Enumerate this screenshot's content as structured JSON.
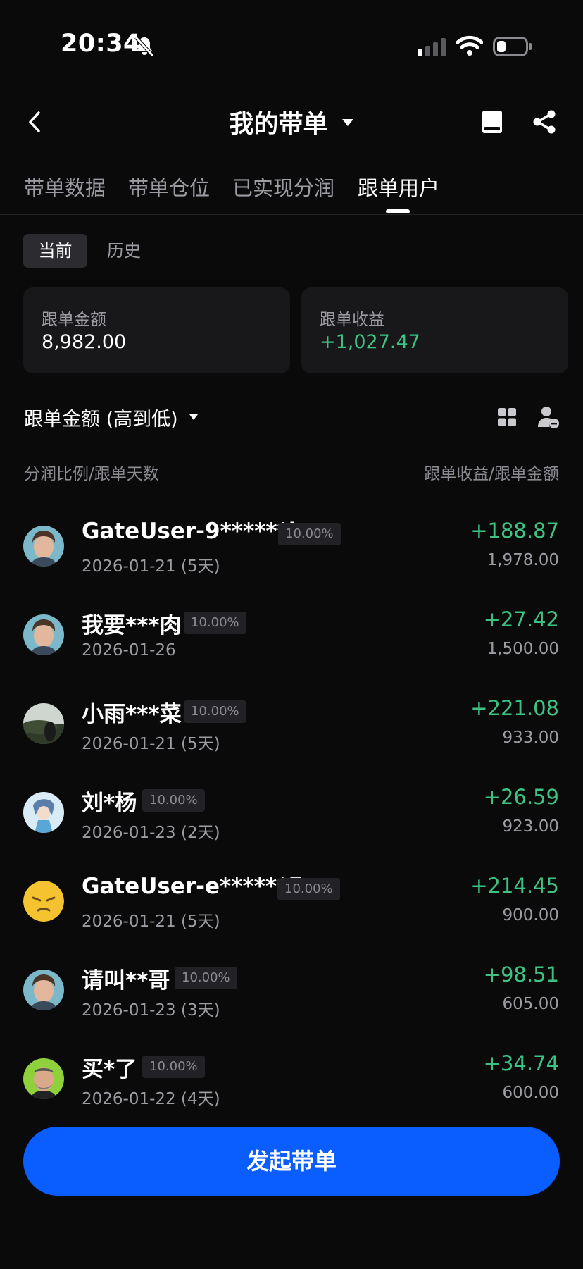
{
  "status_bar": {
    "time": "20:34"
  },
  "nav": {
    "title": "我的带单"
  },
  "tabs": [
    {
      "label": "带单数据"
    },
    {
      "label": "带单仓位"
    },
    {
      "label": "已实现分润"
    },
    {
      "label": "跟单用户"
    }
  ],
  "active_tab": "跟单用户",
  "segments": {
    "current": "当前",
    "history": "历史"
  },
  "summary": {
    "amount_label": "跟单金额",
    "amount_value": "8,982.00",
    "profit_label": "跟单收益",
    "profit_value": "+1,027.47"
  },
  "sort": {
    "label": "跟单金额 (高到低)"
  },
  "columns": {
    "left": "分润比例/跟单天数",
    "right": "跟单收益/跟单金额"
  },
  "followers": [
    {
      "name": "GateUser-9******b",
      "ratio": "10.00%",
      "date": "2026-01-21 (5天)",
      "profit": "+188.87",
      "amount": "1,978.00",
      "avatar": "face-avatar"
    },
    {
      "name": "我要***肉",
      "ratio": "10.00%",
      "date": "2026-01-26",
      "profit": "+27.42",
      "amount": "1,500.00",
      "avatar": "face-avatar"
    },
    {
      "name": "小雨***菜",
      "ratio": "10.00%",
      "date": "2026-01-21 (5天)",
      "profit": "+221.08",
      "amount": "933.00",
      "avatar": "landscape-avatar"
    },
    {
      "name": "刘*杨",
      "ratio": "10.00%",
      "date": "2026-01-23 (2天)",
      "profit": "+26.59",
      "amount": "923.00",
      "avatar": "anime-avatar"
    },
    {
      "name": "GateUser-e******5",
      "ratio": "10.00%",
      "date": "2026-01-21 (5天)",
      "profit": "+214.45",
      "amount": "900.00",
      "avatar": "emoji-avatar"
    },
    {
      "name": "请叫**哥",
      "ratio": "10.00%",
      "date": "2026-01-23 (3天)",
      "profit": "+98.51",
      "amount": "605.00",
      "avatar": "face-avatar"
    },
    {
      "name": "买*了",
      "ratio": "10.00%",
      "date": "2026-01-22 (4天)",
      "profit": "+34.74",
      "amount": "600.00",
      "avatar": "green-face-avatar"
    }
  ],
  "cta": {
    "label": "发起带单"
  },
  "colors": {
    "accent": "#0a5dff",
    "positive": "#3ec283",
    "background": "#0a0a0b",
    "card": "#18181b"
  }
}
